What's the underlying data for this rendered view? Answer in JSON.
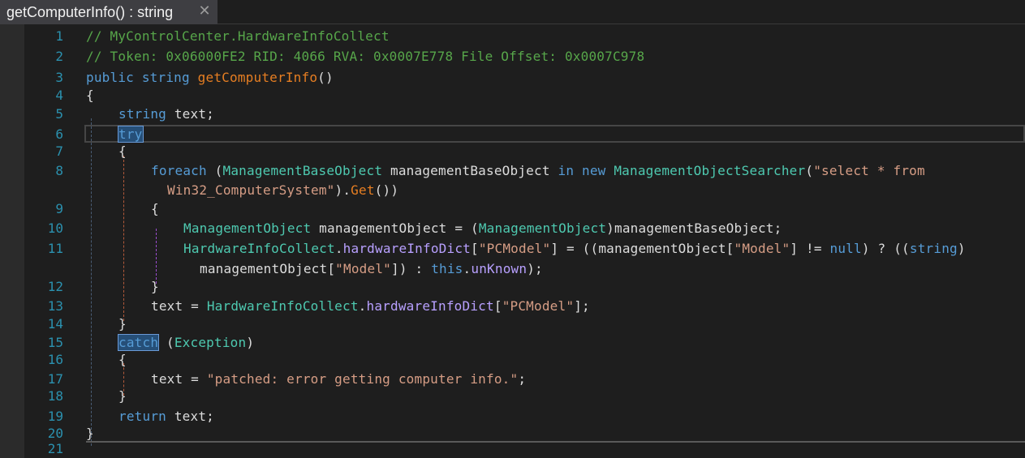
{
  "tab": {
    "title": "getComputerInfo() : string",
    "close_glyph": "✕",
    "close_icon": "close-icon"
  },
  "editor": {
    "line_numbers": [
      "1",
      "2",
      "3",
      "4",
      "5",
      "6",
      "7",
      "8",
      "9",
      "10",
      "11",
      "12",
      "13",
      "14",
      "15",
      "16",
      "17",
      "18",
      "19",
      "20",
      "21"
    ],
    "code": {
      "l1": "// MyControlCenter.HardwareInfoCollect",
      "l2": "// Token: 0x06000FE2 RID: 4066 RVA: 0x0007E778 File Offset: 0x0007C978",
      "l3_kw": "public string ",
      "l3_name": "getComputerInfo",
      "l3_tail": "()",
      "l4": "{",
      "l5_kw": "string",
      "l5_tail": " text;",
      "l6_kw": "try",
      "l7": "{",
      "l8_kw": "foreach",
      "l8_p1": " (",
      "l8_ty1": "ManagementBaseObject",
      "l8_var": " managementBaseObject ",
      "l8_kw2": "in new ",
      "l8_ty2": "ManagementObjectSearcher",
      "l8_p2": "(",
      "l8_str": "\"select * from",
      "l8b_str": "Win32_ComputerSystem\"",
      "l8b_p": ").",
      "l8b_mt": "Get",
      "l8b_tail": "())",
      "l9": "{",
      "l10_ty": "ManagementObject",
      "l10_mid": " managementObject = (",
      "l10_ty2": "ManagementObject",
      "l10_tail": ")managementBaseObject;",
      "l11_ty": "HardwareInfoCollect",
      "l11_dot": ".",
      "l11_fl": "hardwareInfoDict",
      "l11_p1": "[",
      "l11_s1": "\"PCModel\"",
      "l11_p2": "] = ((managementObject[",
      "l11_s2": "\"Model\"",
      "l11_p3": "] != ",
      "l11_kw": "null",
      "l11_p4": ") ? ((",
      "l11_kw2": "string",
      "l11_p5": ")",
      "l11b_p1": "managementObject[",
      "l11b_s": "\"Model\"",
      "l11b_p2": "]) : ",
      "l11b_kw": "this",
      "l11b_dot": ".",
      "l11b_fl": "unKnown",
      "l11b_tail": ");",
      "l12": "}",
      "l13_a": "text = ",
      "l13_ty": "HardwareInfoCollect",
      "l13_dot": ".",
      "l13_fl": "hardwareInfoDict",
      "l13_p": "[",
      "l13_s": "\"PCModel\"",
      "l13_tail": "];",
      "l14": "}",
      "l15_kw": "catch",
      "l15_p1": " (",
      "l15_ty": "Exception",
      "l15_p2": ")",
      "l16": "{",
      "l17_a": "text = ",
      "l17_s": "\"patched: error getting computer info.\"",
      "l17_tail": ";",
      "l18": "}",
      "l19_kw": "return",
      "l19_tail": " text;",
      "l20": "}"
    }
  },
  "colors": {
    "background": "#1e1e1e",
    "line_number": "#2b91af",
    "comment": "#57a64a",
    "keyword": "#569cd6",
    "type": "#4ec9b0",
    "method": "#e67e22",
    "string": "#d69d85",
    "field": "#b8a0ff"
  }
}
